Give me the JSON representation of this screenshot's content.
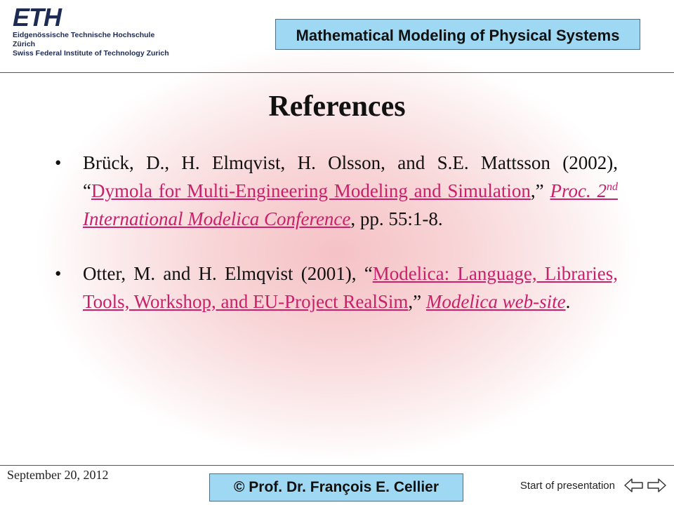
{
  "header": {
    "logo_mark": "ETH",
    "logo_line1": "Eidgenössische Technische Hochschule Zürich",
    "logo_line2": "Swiss Federal Institute of Technology Zurich",
    "course_title": "Mathematical Modeling of Physical Systems"
  },
  "slide": {
    "title": "References",
    "references": [
      {
        "pre": "Brück, D., H. Elmqvist, H. Olsson, and S.E. Mattsson (2002), “",
        "link_title": "Dymola for Multi-Engineering Modeling and Simulation",
        "mid": ",” ",
        "venue_pre": "Proc. 2",
        "venue_sup": "nd",
        "venue_post": " International Modelica Conference",
        "post": ", pp. 55:1-8."
      },
      {
        "pre": "Otter, M. and H. Elmqvist (2001), “",
        "link_title": "Modelica: Language, Libraries, Tools, Workshop, and EU-Project RealSim",
        "mid": ",” ",
        "venue": "Modelica web-site",
        "post": "."
      }
    ]
  },
  "footer": {
    "date": "September 20, 2012",
    "author": "© Prof. Dr. François E. Cellier",
    "start_link": "Start of presentation"
  },
  "colors": {
    "link": "#c8206a",
    "title_box": "#9fd8f2",
    "logo": "#1d2a52"
  }
}
